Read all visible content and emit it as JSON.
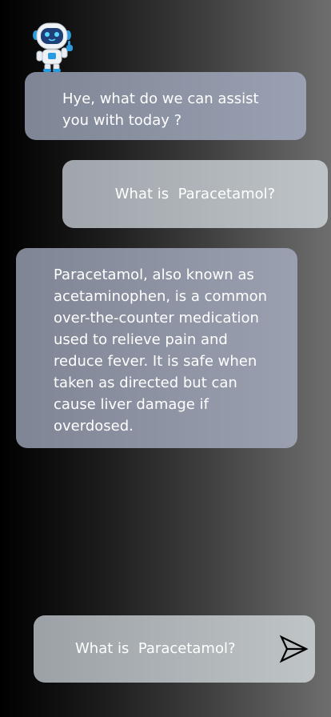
{
  "chat": {
    "greeting": "Hye, what do we can assist you with today ?",
    "user_question": "What is  Paracetamol?",
    "bot_answer": "Paracetamol, also known as acetaminophen, is a common over-the-counter medication used to relieve pain and reduce fever. It is safe when taken as directed but can cause liver damage if overdosed."
  },
  "input": {
    "value": "What is  Paracetamol?"
  },
  "icons": {
    "avatar": "robot-icon",
    "send": "send-icon"
  },
  "colors": {
    "bot_bubble": "#8c93a4",
    "user_bubble": "#b0b6ba",
    "text": "#ffffff"
  }
}
